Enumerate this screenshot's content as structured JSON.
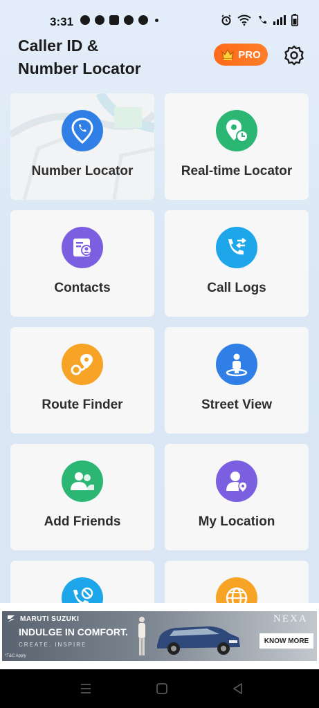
{
  "status_bar": {
    "time": "3:31"
  },
  "header": {
    "title_line1": "Caller ID &",
    "title_line2": "Number Locator",
    "pro_label": "PRO"
  },
  "features": [
    {
      "label": "Number Locator",
      "icon": "location-phone-icon",
      "color": "#2f7fe6"
    },
    {
      "label": "Real-time Locator",
      "icon": "location-clock-icon",
      "color": "#2bb673"
    },
    {
      "label": "Contacts",
      "icon": "contact-card-icon",
      "color": "#7a5fe0"
    },
    {
      "label": "Call Logs",
      "icon": "call-transfer-icon",
      "color": "#1ea6ea"
    },
    {
      "label": "Route Finder",
      "icon": "route-icon",
      "color": "#f7a325"
    },
    {
      "label": "Street View",
      "icon": "street-view-icon",
      "color": "#2f7fe6"
    },
    {
      "label": "Add Friends",
      "icon": "add-friends-icon",
      "color": "#2bb673"
    },
    {
      "label": "My Location",
      "icon": "my-location-icon",
      "color": "#7a5fe0"
    },
    {
      "label": "",
      "icon": "call-block-icon",
      "color": "#1ea6ea"
    },
    {
      "label": "",
      "icon": "globe-icon",
      "color": "#f7a325"
    }
  ],
  "ad": {
    "brand": "MARUTI SUZUKI",
    "headline": "INDULGE IN COMFORT.",
    "tagline": "CREATE. INSPIRE",
    "nexa": "NEXA",
    "cta": "KNOW MORE",
    "disclaimer": "*T&C Apply"
  }
}
